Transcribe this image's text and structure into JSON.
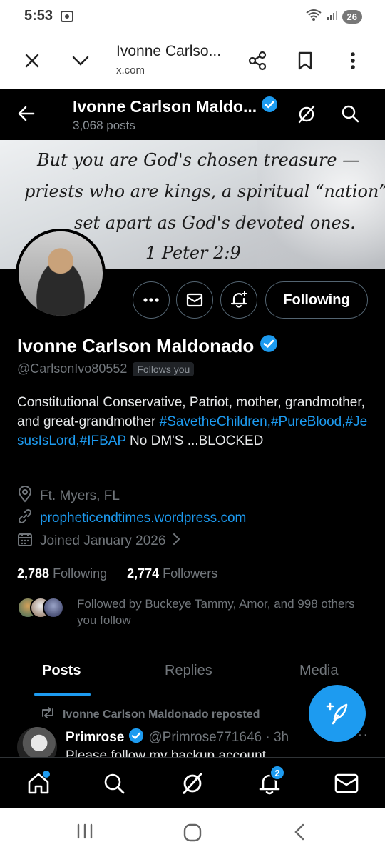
{
  "status_bar": {
    "time": "5:53",
    "battery": "26"
  },
  "browser": {
    "title": "Ivonne Carlso...",
    "domain": "x.com"
  },
  "header": {
    "name": "Ivonne Carlson Maldo...",
    "posts": "3,068 posts"
  },
  "banner": {
    "line1": "But you are God's chosen treasure —",
    "line2": "priests who are kings, a spiritual “nation”",
    "line3": "set apart as God's devoted ones.",
    "line4": "1 Peter 2:9"
  },
  "actions": {
    "following_label": "Following"
  },
  "profile": {
    "name": "Ivonne Carlson Maldonado",
    "handle": "@CarlsonIvo80552",
    "follows_you": "Follows you",
    "bio_text1": "Constitutional Conservative, Patriot, mother, grandmother, and great-grandmother ",
    "bio_tags": "#SavetheChildren,#PureBlood,#JesusIsLord,#IFBAP",
    "bio_text2": " No DM'S ...BLOCKED",
    "location": "Ft. Myers, FL",
    "website": "propheticendtimes.wordpress.com",
    "joined": "Joined January 2026",
    "following_count": "2,788",
    "following_label": "Following",
    "followers_count": "2,774",
    "followers_label": "Followers",
    "followed_by": "Followed by Buckeye Tammy, Amor, and 998 others you follow"
  },
  "tabs": [
    "Posts",
    "Replies",
    "Media"
  ],
  "post": {
    "repost_text": "Ivonne Carlson Maldonado reposted",
    "author": "Primrose",
    "handle_time": "@Primrose771646 · 3h",
    "body": "Please follow my backup account",
    "more": "···"
  },
  "bottom_nav": {
    "notification_count": "2"
  },
  "colors": {
    "accent": "#1d9bf0",
    "background": "#000000",
    "muted": "#71767b"
  }
}
